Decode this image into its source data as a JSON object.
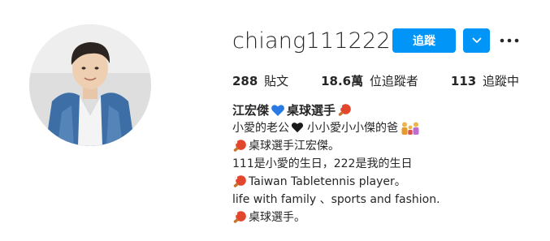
{
  "profile": {
    "username": "chiang111222",
    "verified": true,
    "follow_label": "追蹤",
    "posts_count": "288",
    "posts_label": "貼文",
    "followers_count": "18.6萬",
    "followers_label": "位追蹤者",
    "following_count": "113",
    "following_label": "追蹤中"
  },
  "bio": {
    "name": "江宏傑",
    "name_suffix": "桌球選手",
    "line1": "小愛的老公",
    "line1b": "小小愛小小傑的爸",
    "line2": "桌球選手江宏傑。",
    "line3": "111是小愛的生日，222是我的生日",
    "line4": "Taiwan Tabletennis player。",
    "line5": "life with family 、sports and fashion.",
    "line6": "桌球選手。"
  },
  "icons": {
    "verified": "verified-badge-icon",
    "dropdown": "chevron-down-icon",
    "more": "more-options-icon",
    "heart_blue": "blue-heart-icon",
    "heart_black": "black-heart-icon",
    "paddle": "ping-pong-paddle-icon",
    "family": "family-icon"
  },
  "colors": {
    "accent": "#0095f6",
    "text": "#262626",
    "paddle_red": "#e2462c"
  }
}
